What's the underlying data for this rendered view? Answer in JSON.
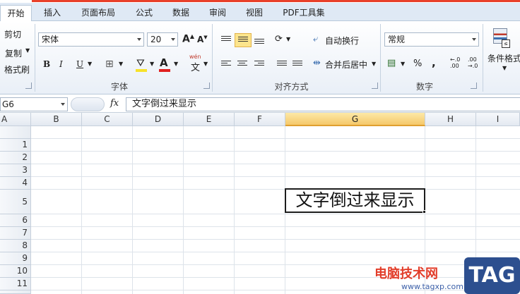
{
  "ribbon_tabs": [
    "开始",
    "插入",
    "页面布局",
    "公式",
    "数据",
    "审阅",
    "视图",
    "PDF工具集"
  ],
  "clipboard": {
    "cut": "剪切",
    "copy": "复制",
    "format_painter": "格式刷"
  },
  "font": {
    "name": "宋体",
    "size": "20",
    "bold": "B",
    "italic": "I",
    "underline": "U",
    "phonetic": "wén",
    "group_label": "字体"
  },
  "alignment": {
    "wrap_text": "自动换行",
    "merge_center": "合并后居中",
    "group_label": "对齐方式"
  },
  "number": {
    "format": "常规",
    "percent": "%",
    "comma": ",",
    "increase_decimal": "←.0\n.00",
    "decrease_decimal": ".00\n→.0",
    "group_label": "数字"
  },
  "styles": {
    "conditional_formatting": "条件格式"
  },
  "formula_bar": {
    "name_box": "G6",
    "fx": "fx",
    "content": "文字倒过来显示"
  },
  "columns": [
    "A",
    "B",
    "C",
    "D",
    "E",
    "F",
    "G",
    "H",
    "I"
  ],
  "selected_column": "G",
  "rows": [
    "",
    "1",
    "2",
    "3",
    "4",
    "5",
    "6",
    "7",
    "8",
    "9",
    "10",
    "11"
  ],
  "cells": {
    "G5": "文字倒过来显示"
  },
  "watermark": {
    "text": "电脑技术网",
    "url": "www.tagxp.com",
    "badge": "TAG"
  },
  "colors": {
    "accent_red": "#e8402a",
    "selection": "#f5c86a",
    "ribbon_bg": "#dfe9f5"
  }
}
